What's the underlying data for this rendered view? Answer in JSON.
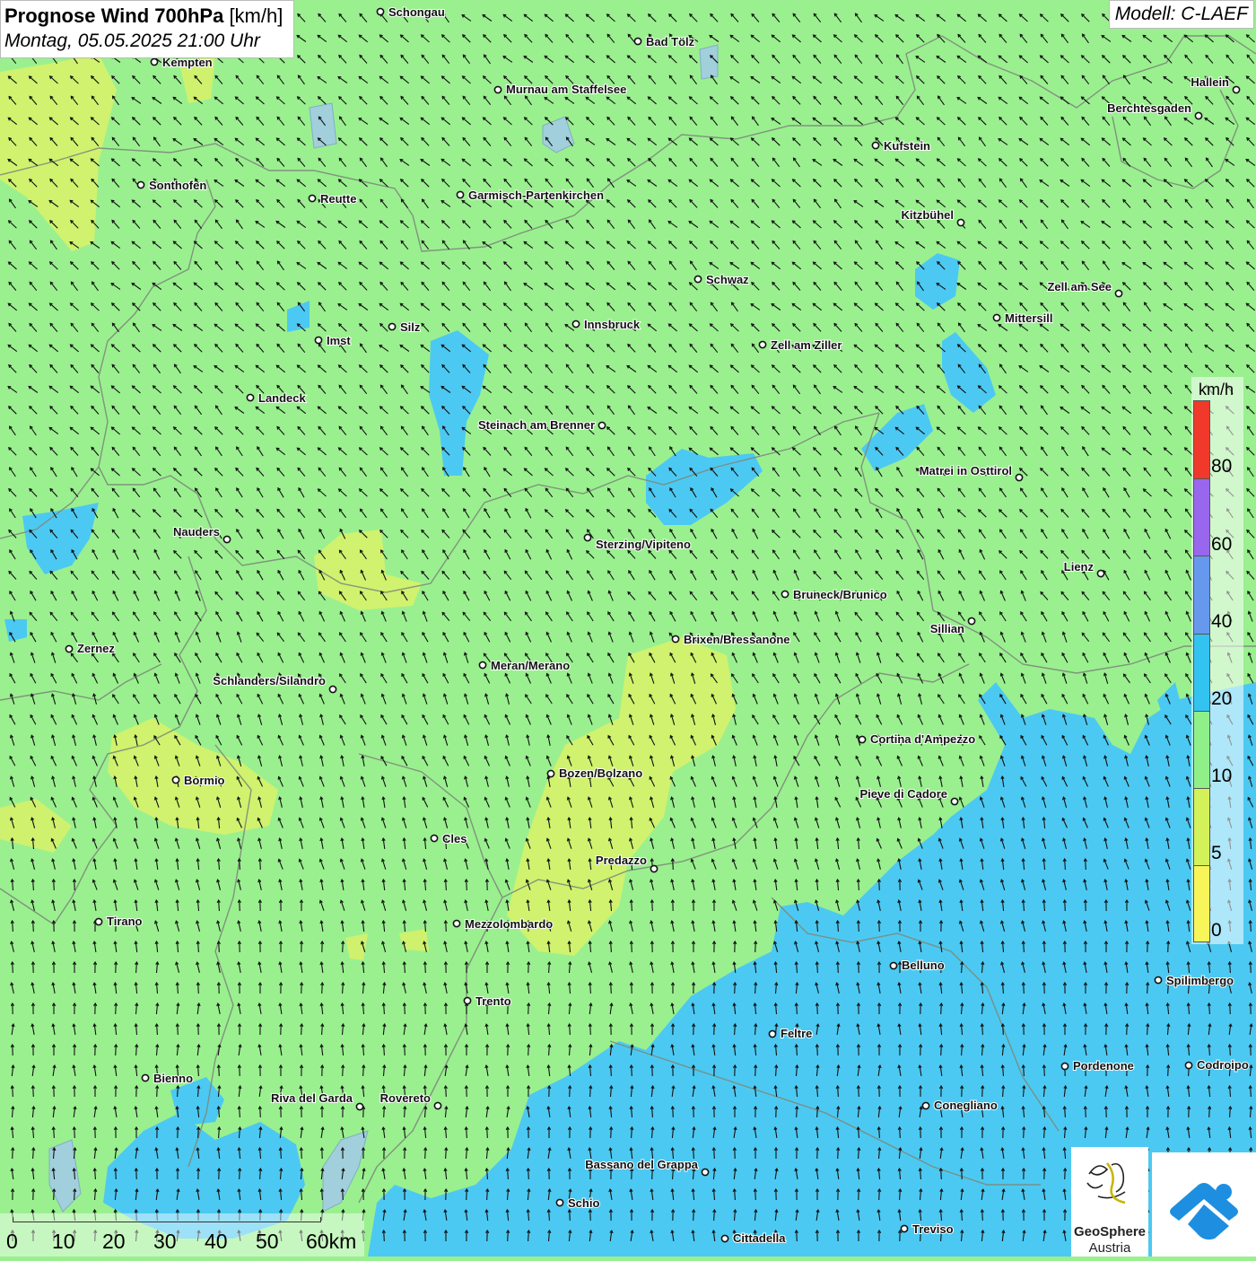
{
  "title": {
    "main": "Prognose Wind 700hPa",
    "unit": "[km/h]",
    "date": "Montag, 05.05.2025 21:00 Uhr"
  },
  "model": "Modell: C-LAEF",
  "legend": {
    "unit": "km/h",
    "labels": [
      "80",
      "60",
      "40",
      "20",
      "10",
      "5",
      "0"
    ],
    "colors": {
      "above80": "#f0392b",
      "c60_80": "#9966ee",
      "c40_60": "#6699ee",
      "c20_40": "#33c3f0",
      "c10_20": "#8ff08a",
      "c5_10": "#d3f25a",
      "c0_5": "#f7f55a"
    }
  },
  "scale": {
    "labels": [
      "0",
      "10",
      "20",
      "30",
      "40",
      "50",
      "60km"
    ]
  },
  "logos": {
    "geosphere_line1": "GeoSphere",
    "geosphere_line2": "Austria"
  },
  "cities": [
    "Schongau",
    "Bad Tölz",
    "Kempten",
    "Murnau am Staffelsee",
    "Hallein",
    "Berchtesgaden",
    "Kufstein",
    "Sonthofen",
    "Reutte",
    "Garmisch-Partenkirchen",
    "Kitzbühel",
    "Schwaz",
    "Zell am See",
    "Silz",
    "Innsbruck",
    "Mittersill",
    "Imst",
    "Zell am Ziller",
    "Landeck",
    "Steinach am Brenner",
    "Matrei in Osttirol",
    "Nauders",
    "Sterzing/Vipiteno",
    "Lienz",
    "Bruneck/Brunico",
    "Sillian",
    "Brixen/Bressanone",
    "Zernez",
    "Meran/Merano",
    "Schlanders/Silandro",
    "Cortina d'Ampezzo",
    "Bozen/Bolzano",
    "Bormio",
    "Pieve di Cadore",
    "Cles",
    "Predazzo",
    "Tirano",
    "Mezzolombardo",
    "Belluno",
    "Spilimbergo",
    "Trento",
    "Feltre",
    "Pordenone",
    "Codroipo",
    "Bienno",
    "Riva del Garda",
    "Rovereto",
    "Conegliano",
    "Bassano del Grappa",
    "Schio",
    "Treviso",
    "Cittadella"
  ]
}
